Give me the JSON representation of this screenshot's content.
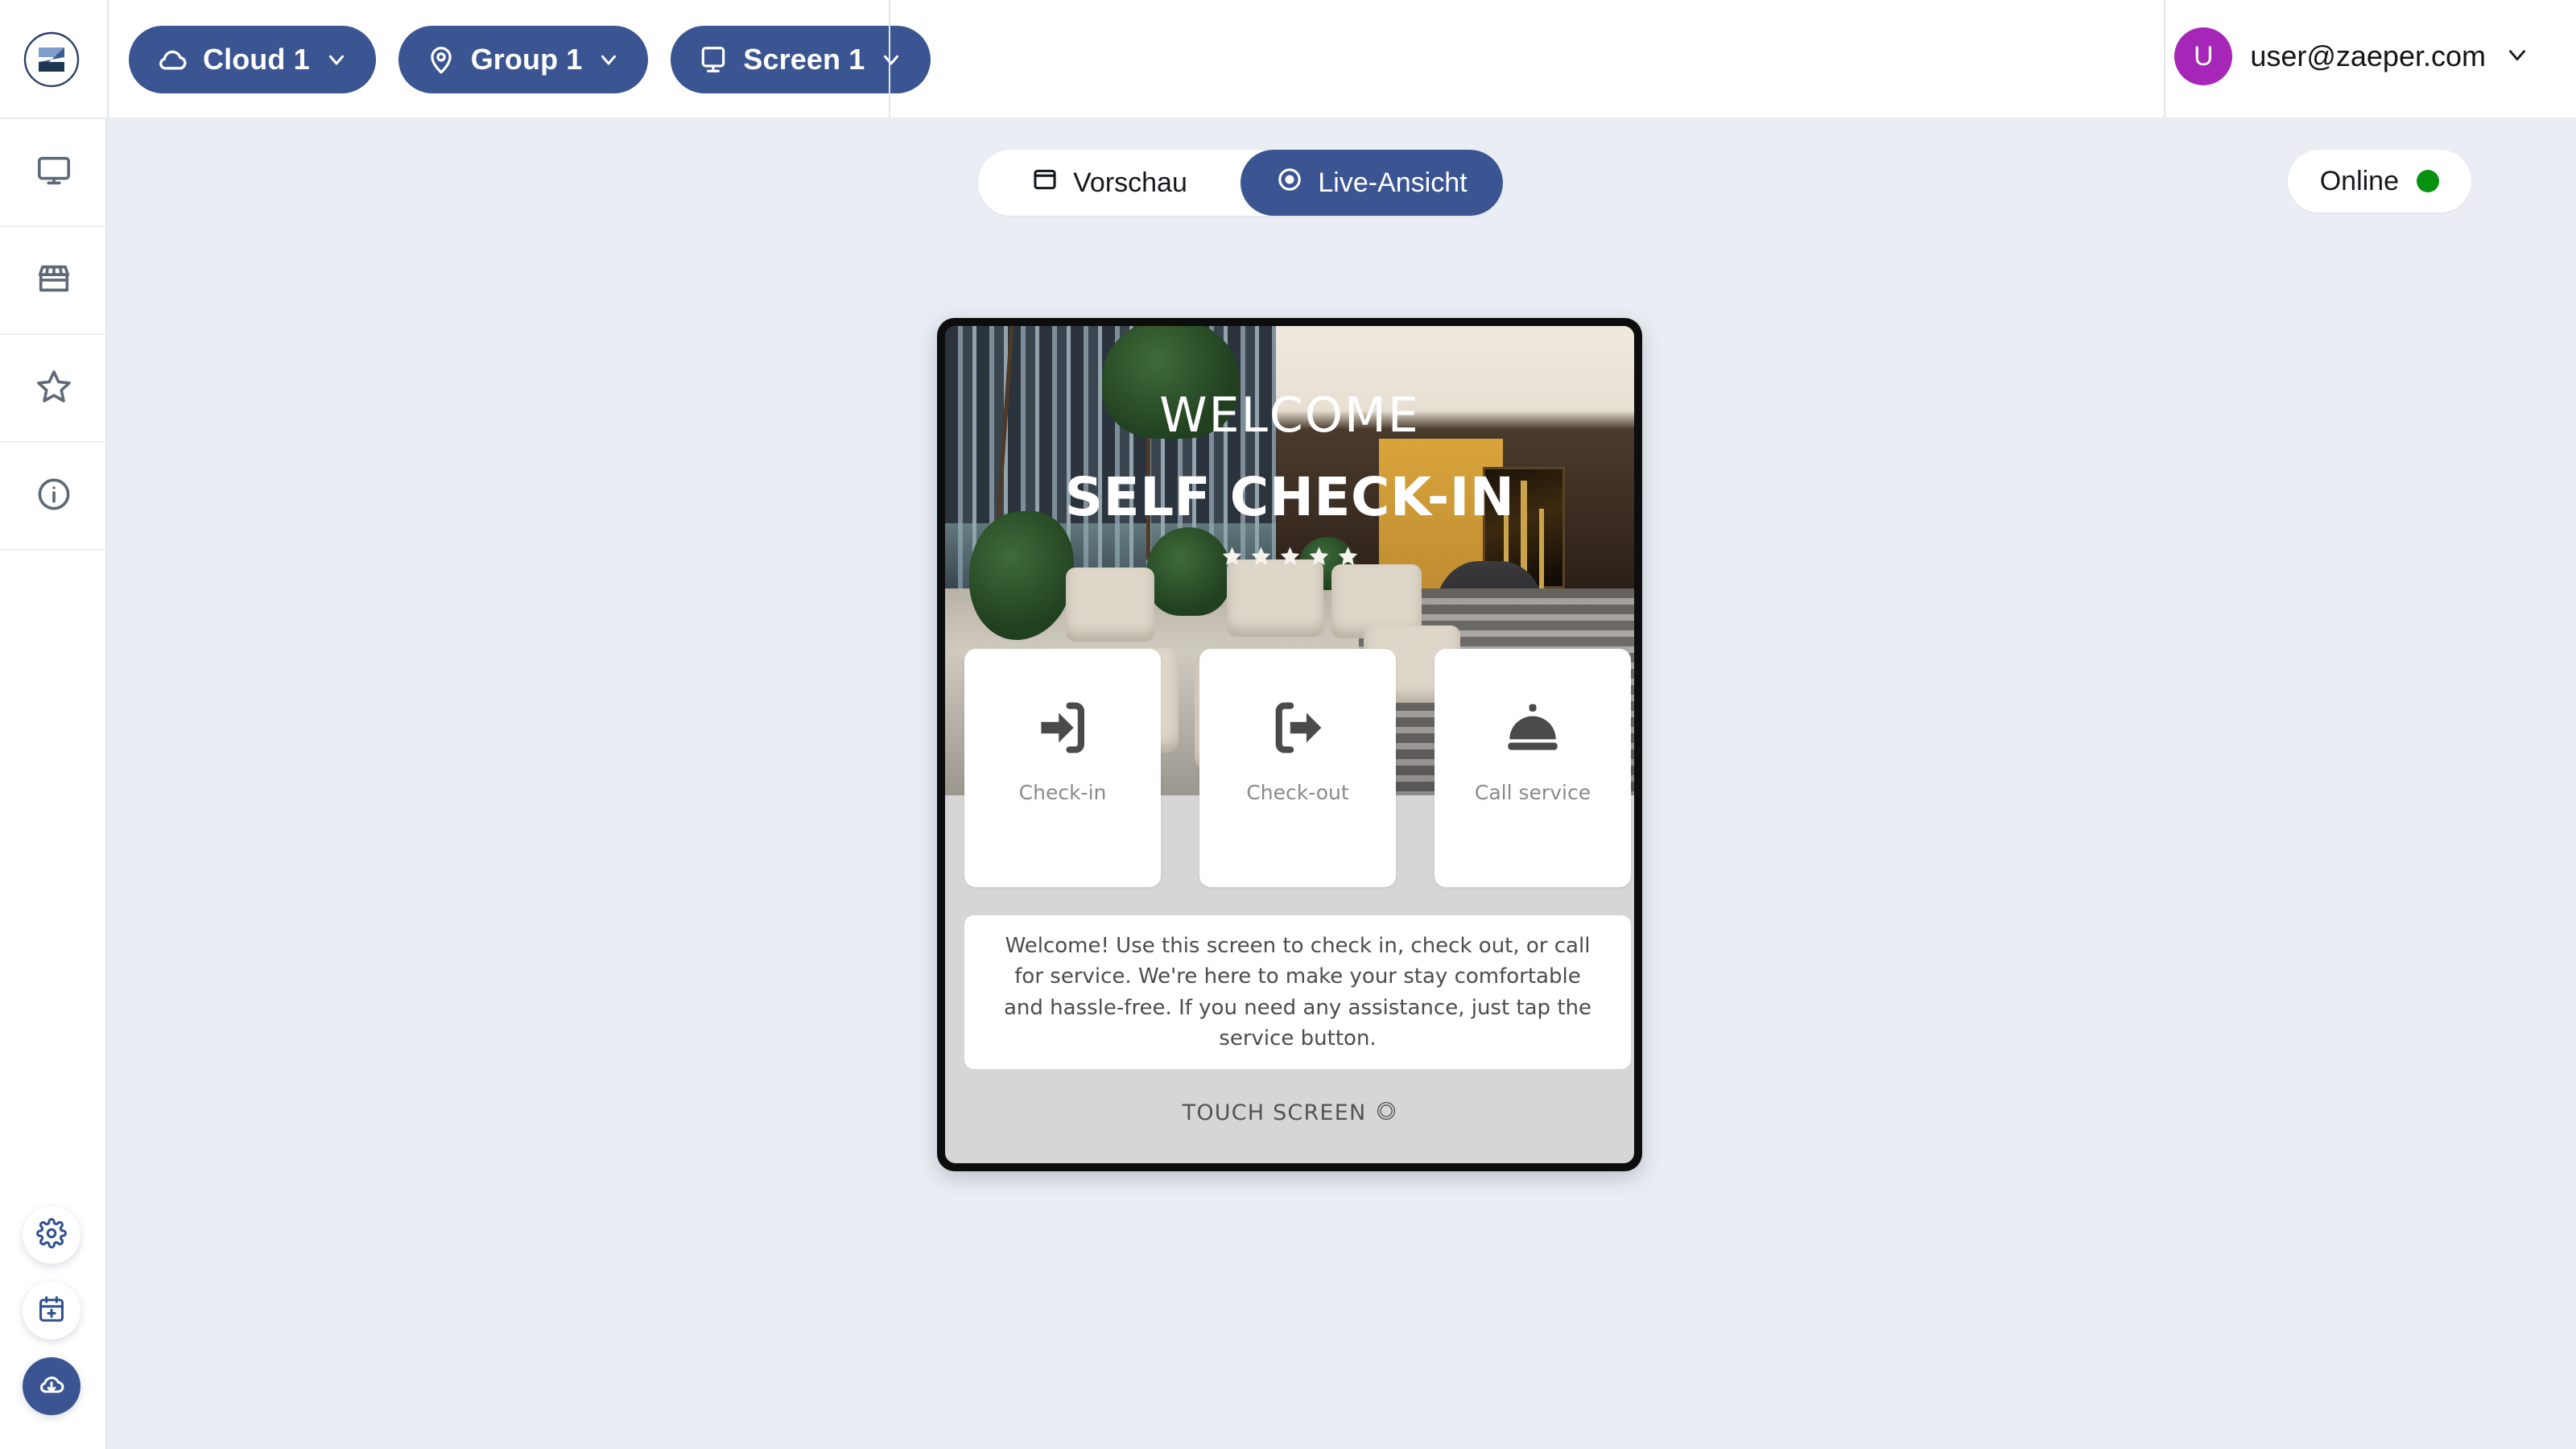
{
  "header": {
    "logo": "zaeper-logo",
    "nav_pills": [
      {
        "icon": "cloud-icon",
        "label": "Cloud 1",
        "chevron": "chevron-down-icon"
      },
      {
        "icon": "location-pin-icon",
        "label": "Group 1",
        "chevron": "chevron-down-icon"
      },
      {
        "icon": "monitor-icon",
        "label": "Screen 1",
        "chevron": "chevron-down-icon"
      }
    ],
    "user": {
      "avatar_initial": "U",
      "email": "user@zaeper.com",
      "avatar_color": "#a626b8"
    }
  },
  "sidebar": {
    "items": [
      {
        "icon": "monitor-icon",
        "name": "screens"
      },
      {
        "icon": "store-icon",
        "name": "marketplace"
      },
      {
        "icon": "star-icon",
        "name": "favorites"
      },
      {
        "icon": "info-icon",
        "name": "info"
      }
    ],
    "fabs": [
      {
        "icon": "gear-icon",
        "name": "settings",
        "active": false
      },
      {
        "icon": "calendar-plus-icon",
        "name": "schedule",
        "active": false
      },
      {
        "icon": "cloud-download-icon",
        "name": "publish",
        "active": true
      }
    ]
  },
  "toolbar": {
    "view_toggle": {
      "preview_label": "Vorschau",
      "preview_icon": "window-icon",
      "live_label": "Live-Ansicht",
      "live_icon": "radio-selected-icon",
      "active": "live"
    },
    "status": {
      "label": "Online",
      "dot_color": "#069210"
    }
  },
  "screen_preview": {
    "hero": {
      "title_top": "WELCOME",
      "title_main": "SELF CHECK-IN",
      "star_count": 5
    },
    "cards": [
      {
        "icon": "login-arrow-icon",
        "label": "Check-in"
      },
      {
        "icon": "logout-arrow-icon",
        "label": "Check-out"
      },
      {
        "icon": "service-bell-icon",
        "label": "Call service"
      }
    ],
    "info_text": "Welcome! Use this screen to check in, check out, or call for service. We're here to make your stay comfortable and hassle-free. If you need any assistance, just tap the service button.",
    "footer": {
      "label": "TOUCH SCREEN",
      "icon": "circle-ring-icon"
    }
  },
  "colors": {
    "brand_blue": "#3a5592",
    "canvas_bg": "#eaeef4",
    "screen_bg": "#d6d6d6",
    "online_green": "#069210",
    "avatar_purple": "#a626b8"
  }
}
